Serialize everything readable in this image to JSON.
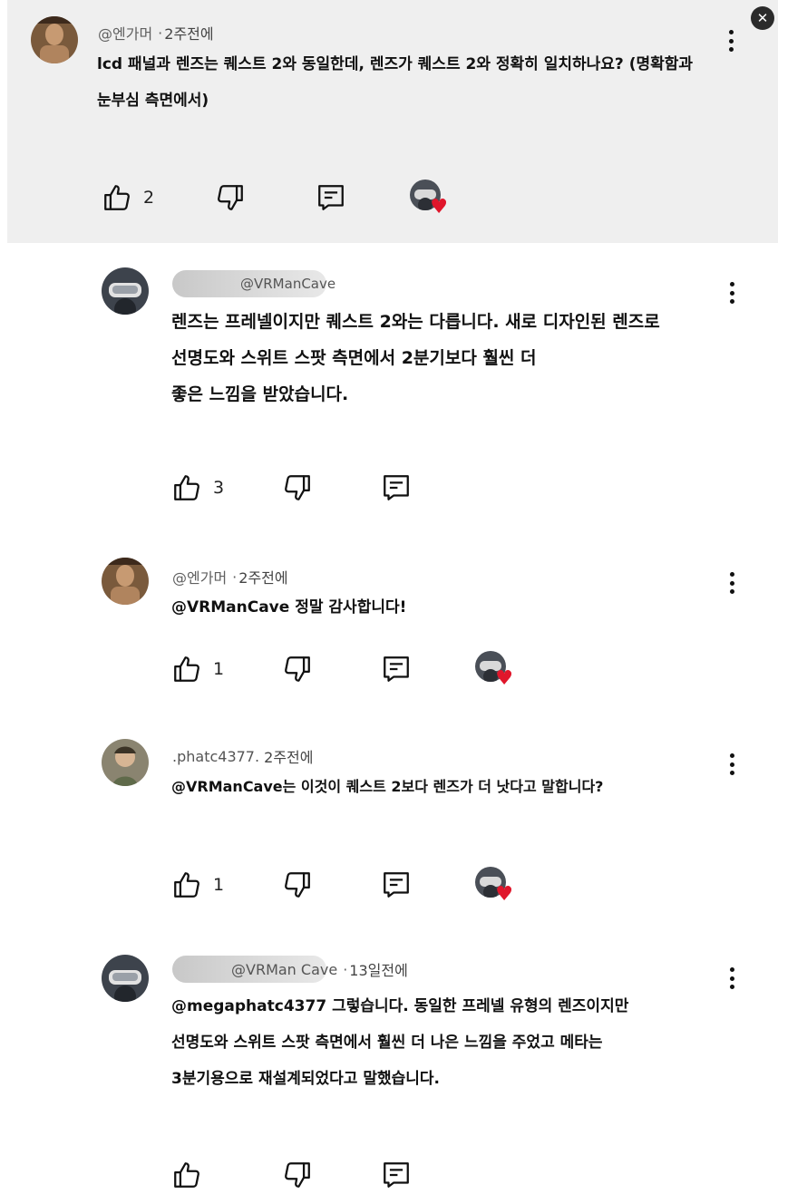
{
  "close_label": "✕",
  "comments": [
    {
      "handle": "@엔가머",
      "time": "2주전에",
      "lines": [
        "lcd 패널과 렌즈는 퀘스트 2와 동일한데, 렌즈가 퀘스트 2와 정확히 일치하나요? (명확함과",
        "눈부심 측면에서)"
      ],
      "likes": "2",
      "creator_heart": true
    },
    {
      "handle": "@VRManCave",
      "time": "",
      "lines": [
        "렌즈는 프레넬이지만 퀘스트 2와는 다릅니다. 새로 디자인된 렌즈로",
        "선명도와 스위트 스팟 측면에서 2분기보다 훨씬 더",
        "좋은 느낌을 받았습니다."
      ],
      "likes": "3",
      "creator_heart": false
    },
    {
      "handle": "@엔가머",
      "time": "2주전에",
      "lines": [
        "@VRManCave 정말 감사합니다!"
      ],
      "likes": "1",
      "creator_heart": true
    },
    {
      "handle": ".phatc4377.",
      "time": "2주전에",
      "lines": [
        "@VRManCave는 이것이 퀘스트 2보다 렌즈가 더 낫다고 말합니다?"
      ],
      "likes": "1",
      "creator_heart": true
    },
    {
      "handle": "@VRMan Cave",
      "time": "13일전에",
      "lines": [
        "@megaphatc4377 그렇습니다. 동일한 프레넬 유형의 렌즈이지만",
        "선명도와 스위트 스팟 측면에서 훨씬 더 나은 느낌을 주었고 메타는",
        "3분기용으로 재설계되었다고 말했습니다."
      ],
      "likes": "",
      "creator_heart": false
    }
  ],
  "icons": {
    "like": "thumbs-up-icon",
    "dislike": "thumbs-down-icon",
    "reply": "reply-icon",
    "more": "more-vertical-icon",
    "heart": "heart-icon",
    "close": "close-icon"
  },
  "colors": {
    "highlight_bg": "#efefef",
    "heart": "#e0162b",
    "meta_text": "#606060"
  }
}
